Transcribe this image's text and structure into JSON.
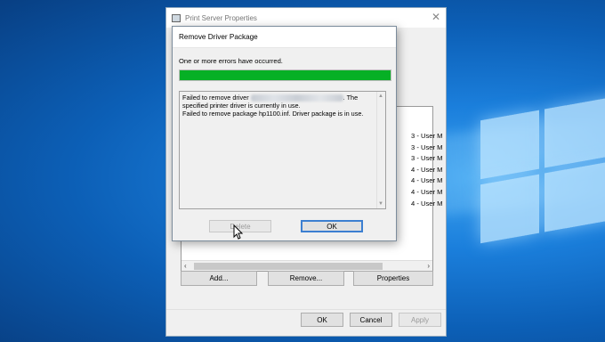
{
  "print_server_window": {
    "title": "Print Server Properties",
    "close_glyph": "✕",
    "driver_rows": [
      "3 - User M",
      "3 - User M",
      "3 - User M",
      "4 - User M",
      "4 - User M",
      "4 - User M",
      "4 - User M"
    ],
    "scroll_left": "‹",
    "scroll_right": "›",
    "buttons": {
      "add": "Add...",
      "remove": "Remove...",
      "properties": "Properties"
    },
    "footer_buttons": {
      "ok": "OK",
      "cancel": "Cancel",
      "apply": "Apply"
    }
  },
  "remove_driver_dialog": {
    "title": "Remove Driver Package",
    "error_message": "One or more errors have occurred.",
    "progress_fraction": 1.0,
    "details": {
      "line1_prefix": "Failed to remove driver",
      "line1_suffix": ". The specified printer driver is currently in use.",
      "line2": "Failed to remove package hp1100.inf. Driver package is in use."
    },
    "scroll_up": "▲",
    "scroll_down": "▼",
    "buttons": {
      "delete": "Delete",
      "ok": "OK"
    }
  },
  "colors": {
    "progress_green": "#06b025",
    "desktop_blue": "#0c5fb6",
    "default_button_border": "#3c7fd1"
  },
  "icons": [
    "printer-icon",
    "close-icon",
    "mouse-pointer-icon",
    "windows-logo"
  ]
}
